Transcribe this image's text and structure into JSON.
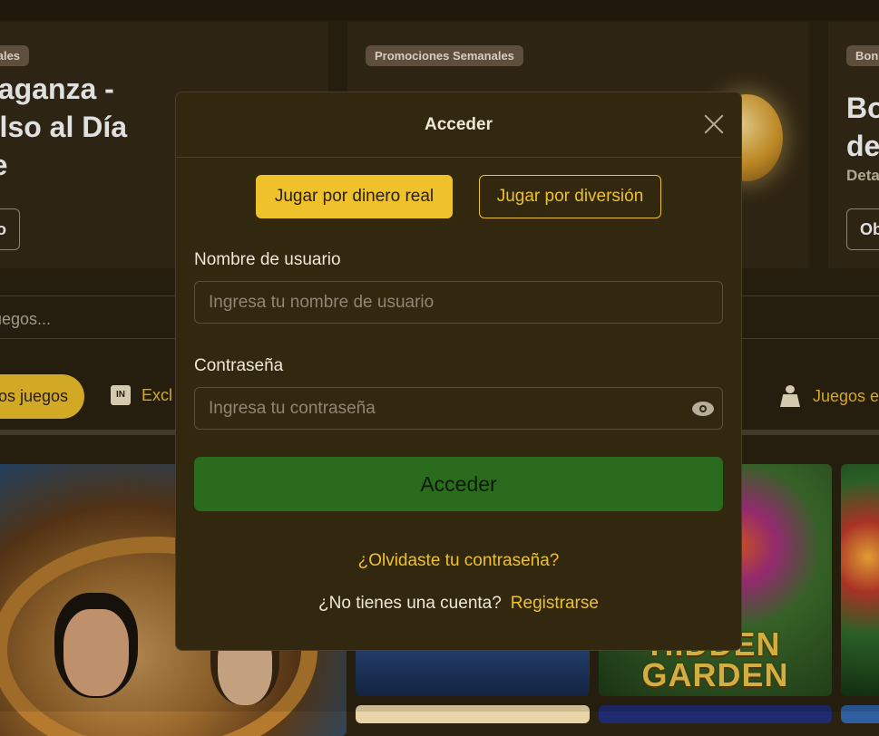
{
  "promos": [
    {
      "badge": "manales",
      "title_lines": [
        "vaganza -",
        "olso al Día",
        "te"
      ],
      "button": "no"
    },
    {
      "badge": "Promociones Semanales"
    },
    {
      "badge": "Bon",
      "title_lines": [
        "Bo",
        "de"
      ],
      "subtitle": "Deta",
      "button": "Ob"
    }
  ],
  "search": {
    "partial_text": "uegos..."
  },
  "categories": [
    {
      "label": "os juegos",
      "active": true
    },
    {
      "label": "Excl",
      "icon": "in-exclusive-icon"
    },
    {
      "label": "Juegos e",
      "icon": "live-dealer-icon"
    }
  ],
  "games": {
    "garden_title_lines": [
      "HIDDEN",
      "GARDEN"
    ]
  },
  "modal": {
    "title": "Acceder",
    "mode_real": "Jugar por dinero real",
    "mode_fun": "Jugar por diversión",
    "username_label": "Nombre de usuario",
    "username_placeholder": "Ingresa tu nombre de usuario",
    "password_label": "Contraseña",
    "password_placeholder": "Ingresa tu contraseña",
    "submit": "Acceder",
    "forgot": "¿Olvidaste tu contraseña?",
    "no_account": "¿No tienes una cuenta?",
    "register": "Registrarse"
  },
  "colors": {
    "background": "#2b220f",
    "card": "#352a16",
    "accent": "#efc12a",
    "submit_green": "#2a6b1d",
    "modal_bg": "#32270f"
  }
}
